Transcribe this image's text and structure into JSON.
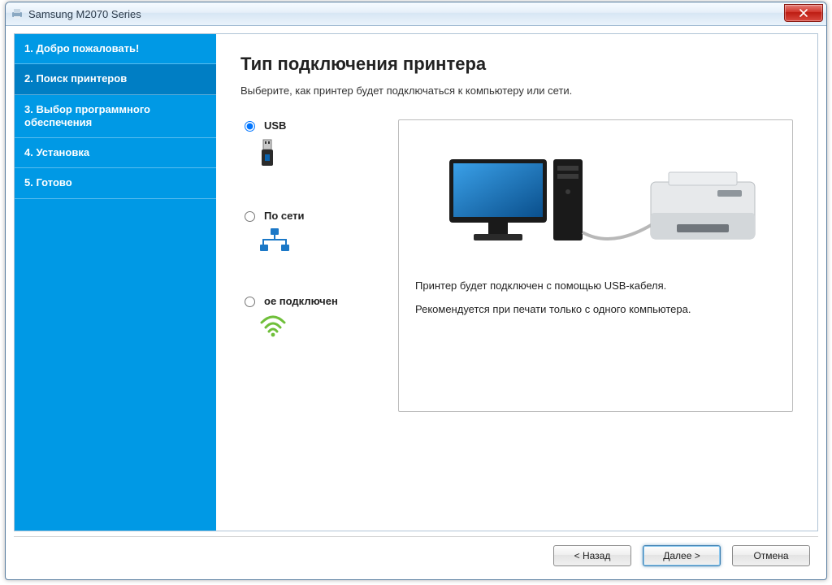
{
  "titlebar": {
    "title": "Samsung M2070 Series"
  },
  "sidebar": {
    "steps": [
      {
        "label": "1. Добро пожаловать!"
      },
      {
        "label": "2. Поиск принтеров"
      },
      {
        "label": "3. Выбор программного обеспечения"
      },
      {
        "label": "4. Установка"
      },
      {
        "label": "5. Готово"
      }
    ],
    "active_index": 1
  },
  "main": {
    "heading": "Тип подключения принтера",
    "subheading": "Выберите, как принтер будет подключаться к компьютеру или сети.",
    "options": [
      {
        "id": "usb",
        "label": "USB",
        "icon": "usb-icon",
        "selected": true
      },
      {
        "id": "net",
        "label": "По сети",
        "icon": "net-icon",
        "selected": false
      },
      {
        "id": "wifi",
        "label": "ое подключен",
        "icon": "wifi-icon",
        "selected": false
      }
    ],
    "description": {
      "line1": "Принтер будет подключен с помощью USB-кабеля.",
      "line2": "Рекомендуется при печати только с одного компьютера."
    }
  },
  "footer": {
    "back": "< Назад",
    "next": "Далее >",
    "cancel": "Отмена"
  },
  "icons": {
    "printer_app": "printer-app-icon",
    "close": "close-icon",
    "usb": "usb-plug-icon",
    "network": "network-topology-icon",
    "wifi": "wifi-signal-icon",
    "monitor": "monitor-icon",
    "tower": "pc-tower-icon",
    "printer": "laser-printer-icon"
  }
}
